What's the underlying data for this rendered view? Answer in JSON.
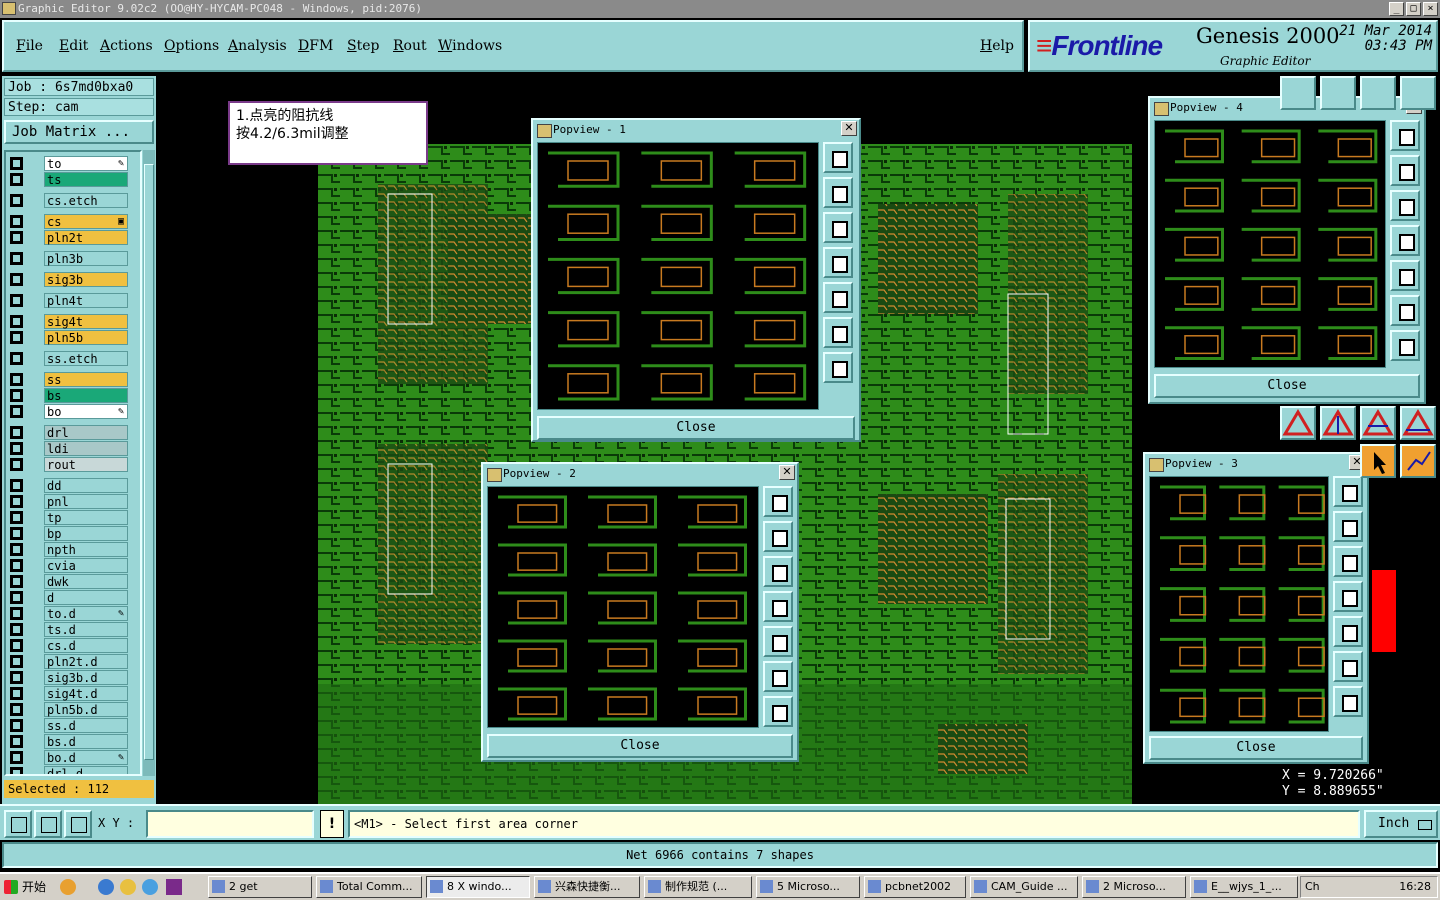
{
  "window": {
    "title": "Graphic Editor 9.02c2 (OO@HY-HYCAM-PC048 - Windows, pid:2076)",
    "buttons": [
      "_",
      "□",
      "×"
    ]
  },
  "menu": {
    "items": [
      "File",
      "Edit",
      "Actions",
      "Options",
      "Analysis",
      "DFM",
      "Step",
      "Rout",
      "Windows"
    ],
    "help": "Help"
  },
  "brand": {
    "logo": "Frontline",
    "product": "Genesis 2000",
    "subtitle": "Graphic Editor",
    "date": "21 Mar 2014",
    "time": "03:43 PM"
  },
  "job": {
    "job_line": "Job : 6s7md0bxa0",
    "step_line": "Step: cam",
    "matrix_button": "Job Matrix ..."
  },
  "layers": [
    {
      "name": "to",
      "color": "#ffffff",
      "mark": "✎"
    },
    {
      "name": "ts",
      "color": "#1aa878",
      "mark": ""
    },
    {
      "name": "cs.etch",
      "color": "#9ad6d6",
      "mark": ""
    },
    {
      "name": "cs",
      "color": "#f0c040",
      "mark": "▣"
    },
    {
      "name": "pln2t",
      "color": "#f0c040",
      "mark": ""
    },
    {
      "name": "pln3b",
      "color": "#9ad6d6",
      "mark": ""
    },
    {
      "name": "sig3b",
      "color": "#f0c040",
      "mark": ""
    },
    {
      "name": "pln4t",
      "color": "#9ad6d6",
      "mark": ""
    },
    {
      "name": "sig4t",
      "color": "#f0c040",
      "mark": ""
    },
    {
      "name": "pln5b",
      "color": "#f0c040",
      "mark": ""
    },
    {
      "name": "ss.etch",
      "color": "#9ad6d6",
      "mark": ""
    },
    {
      "name": "ss",
      "color": "#f0c040",
      "mark": ""
    },
    {
      "name": "bs",
      "color": "#1aa878",
      "mark": ""
    },
    {
      "name": "bo",
      "color": "#ffffff",
      "mark": "✎"
    },
    {
      "name": "drl",
      "color": "#a8c8c8",
      "mark": ""
    },
    {
      "name": "ldi",
      "color": "#a8c8c8",
      "mark": ""
    },
    {
      "name": "rout",
      "color": "#c8d8d8",
      "mark": ""
    },
    {
      "name": "dd",
      "color": "#9ad6d6",
      "mark": ""
    },
    {
      "name": "pnl",
      "color": "#9ad6d6",
      "mark": ""
    },
    {
      "name": "tp",
      "color": "#9ad6d6",
      "mark": ""
    },
    {
      "name": "bp",
      "color": "#9ad6d6",
      "mark": ""
    },
    {
      "name": "npth",
      "color": "#9ad6d6",
      "mark": ""
    },
    {
      "name": "cvia",
      "color": "#9ad6d6",
      "mark": ""
    },
    {
      "name": "dwk",
      "color": "#9ad6d6",
      "mark": ""
    },
    {
      "name": "d",
      "color": "#9ad6d6",
      "mark": ""
    },
    {
      "name": "to.d",
      "color": "#9ad6d6",
      "mark": "✎"
    },
    {
      "name": "ts.d",
      "color": "#9ad6d6",
      "mark": ""
    },
    {
      "name": "cs.d",
      "color": "#9ad6d6",
      "mark": ""
    },
    {
      "name": "pln2t.d",
      "color": "#9ad6d6",
      "mark": ""
    },
    {
      "name": "sig3b.d",
      "color": "#9ad6d6",
      "mark": ""
    },
    {
      "name": "sig4t.d",
      "color": "#9ad6d6",
      "mark": ""
    },
    {
      "name": "pln5b.d",
      "color": "#9ad6d6",
      "mark": ""
    },
    {
      "name": "ss.d",
      "color": "#9ad6d6",
      "mark": ""
    },
    {
      "name": "bs.d",
      "color": "#9ad6d6",
      "mark": ""
    },
    {
      "name": "bo.d",
      "color": "#9ad6d6",
      "mark": "✎"
    },
    {
      "name": "drl.d",
      "color": "#9ad6d6",
      "mark": ""
    }
  ],
  "selected": "Selected : 112",
  "note": {
    "line1": "1.点亮的阻抗线",
    "line2": "按4.2/6.3mil调整"
  },
  "popviews": [
    {
      "title": "Popview - 1",
      "close": "Close"
    },
    {
      "title": "Popview - 2",
      "close": "Close"
    },
    {
      "title": "Popview - 3",
      "close": "Close"
    },
    {
      "title": "Popview - 4",
      "close": "Close"
    }
  ],
  "coords": {
    "x": "X = 9.720266\"",
    "y": "Y = 8.889655\""
  },
  "bottom": {
    "xy_label": "X Y :",
    "xy_value": "",
    "warn": "!",
    "prompt": "<M1> - Select first area corner",
    "units": "Inch"
  },
  "status": "Net 6966 contains 7 shapes",
  "taskbar": {
    "start": "开始",
    "items": [
      "2 get",
      "Total Comm...",
      "8 X windo...",
      "兴森快捷衡...",
      "制作规范 (...",
      "5 Microso...",
      "pcbnet2002",
      "CAM_Guide ...",
      "2 Microso...",
      "E__wjys_1_..."
    ],
    "clock": "16:28",
    "tray_prefix": "Ch"
  },
  "colors": {
    "panel": "#9ad6d6",
    "pcb_green": "#2e8c1a",
    "trace_orange": "#c87a20",
    "highlight": "#f0c040"
  }
}
